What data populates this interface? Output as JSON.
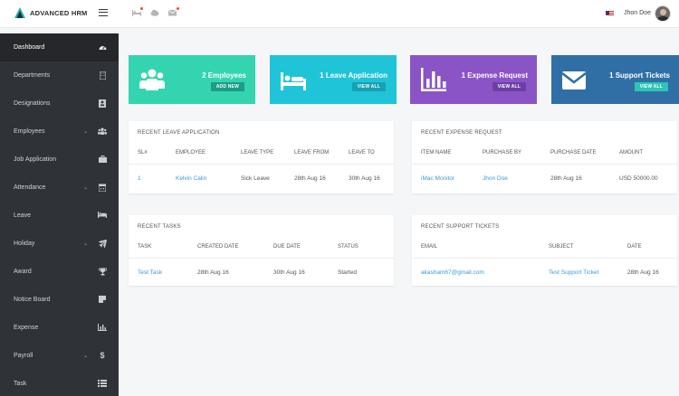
{
  "brand": {
    "name": "ADVANCED HRM"
  },
  "topbar": {
    "user_name": "Jhon Doe",
    "icons": [
      "bed-icon",
      "cloud-icon",
      "mail-icon"
    ]
  },
  "sidebar": {
    "items": [
      {
        "label": "Dashboard",
        "icon": "dashboard-icon",
        "active": true,
        "caret": ""
      },
      {
        "label": "Departments",
        "icon": "building-icon",
        "caret": ""
      },
      {
        "label": "Designations",
        "icon": "id-card-icon",
        "caret": ""
      },
      {
        "label": "Employees",
        "icon": "users-icon",
        "caret": "⌄"
      },
      {
        "label": "Job Application",
        "icon": "briefcase-icon",
        "caret": ""
      },
      {
        "label": "Attendance",
        "icon": "calendar-icon",
        "caret": "⌄"
      },
      {
        "label": "Leave",
        "icon": "bed-icon",
        "caret": ""
      },
      {
        "label": "Holiday",
        "icon": "plane-icon",
        "caret": "⌄"
      },
      {
        "label": "Award",
        "icon": "trophy-icon",
        "caret": ""
      },
      {
        "label": "Notice Board",
        "icon": "notice-icon",
        "caret": ""
      },
      {
        "label": "Expense",
        "icon": "bar-chart-icon",
        "caret": ""
      },
      {
        "label": "Payroll",
        "icon": "dollar-icon",
        "caret": "⌄"
      },
      {
        "label": "Task",
        "icon": "list-icon",
        "caret": ""
      }
    ]
  },
  "stats": [
    {
      "title": "2 Employees",
      "button": "ADD NEW",
      "color": "#34d4b1",
      "icon": "users-icon"
    },
    {
      "title": "1 Leave Application",
      "button": "VIEW ALL",
      "color": "#20c4d8",
      "icon": "bed-icon"
    },
    {
      "title": "1 Expense Request",
      "button": "VIEW ALL",
      "color": "#8a54c7",
      "icon": "bar-chart-icon"
    },
    {
      "title": "1 Support Tickets",
      "button": "VIEW ALL",
      "color": "#2f6fa5",
      "icon": "envelope-icon"
    }
  ],
  "leave": {
    "title": "RECENT LEAVE APPLICATION",
    "headers": [
      "SL#",
      "EMPLOYEE",
      "LEAVE TYPE",
      "LEAVE FROM",
      "LEAVE TO"
    ],
    "row": [
      "1",
      "Kelvin Calin",
      "Sick Leave",
      "28th Aug 16",
      "30th Aug 16"
    ]
  },
  "expense": {
    "title": "RECENT EXPENSE REQUEST",
    "headers": [
      "ITEM NAME",
      "PURCHASE BY",
      "PURCHASE DATE",
      "AMOUNT"
    ],
    "row": [
      "iMac Monitor",
      "Jhon Doe",
      "28th Aug 16",
      "USD 50000.00"
    ]
  },
  "tasks": {
    "title": "RECENT TASKS",
    "headers": [
      "TASK",
      "CREATED DATE",
      "DUE DATE",
      "STATUS"
    ],
    "row": [
      "Test Task",
      "28th Aug 16",
      "30th Aug 16",
      "Started"
    ]
  },
  "tickets": {
    "title": "RECENT SUPPORT TICKETS",
    "headers": [
      "EMAIL",
      "SUBJECT",
      "DATE"
    ],
    "row": [
      "akasham67@gmail.com",
      "Test Support Ticket",
      "28th Aug 16"
    ]
  }
}
